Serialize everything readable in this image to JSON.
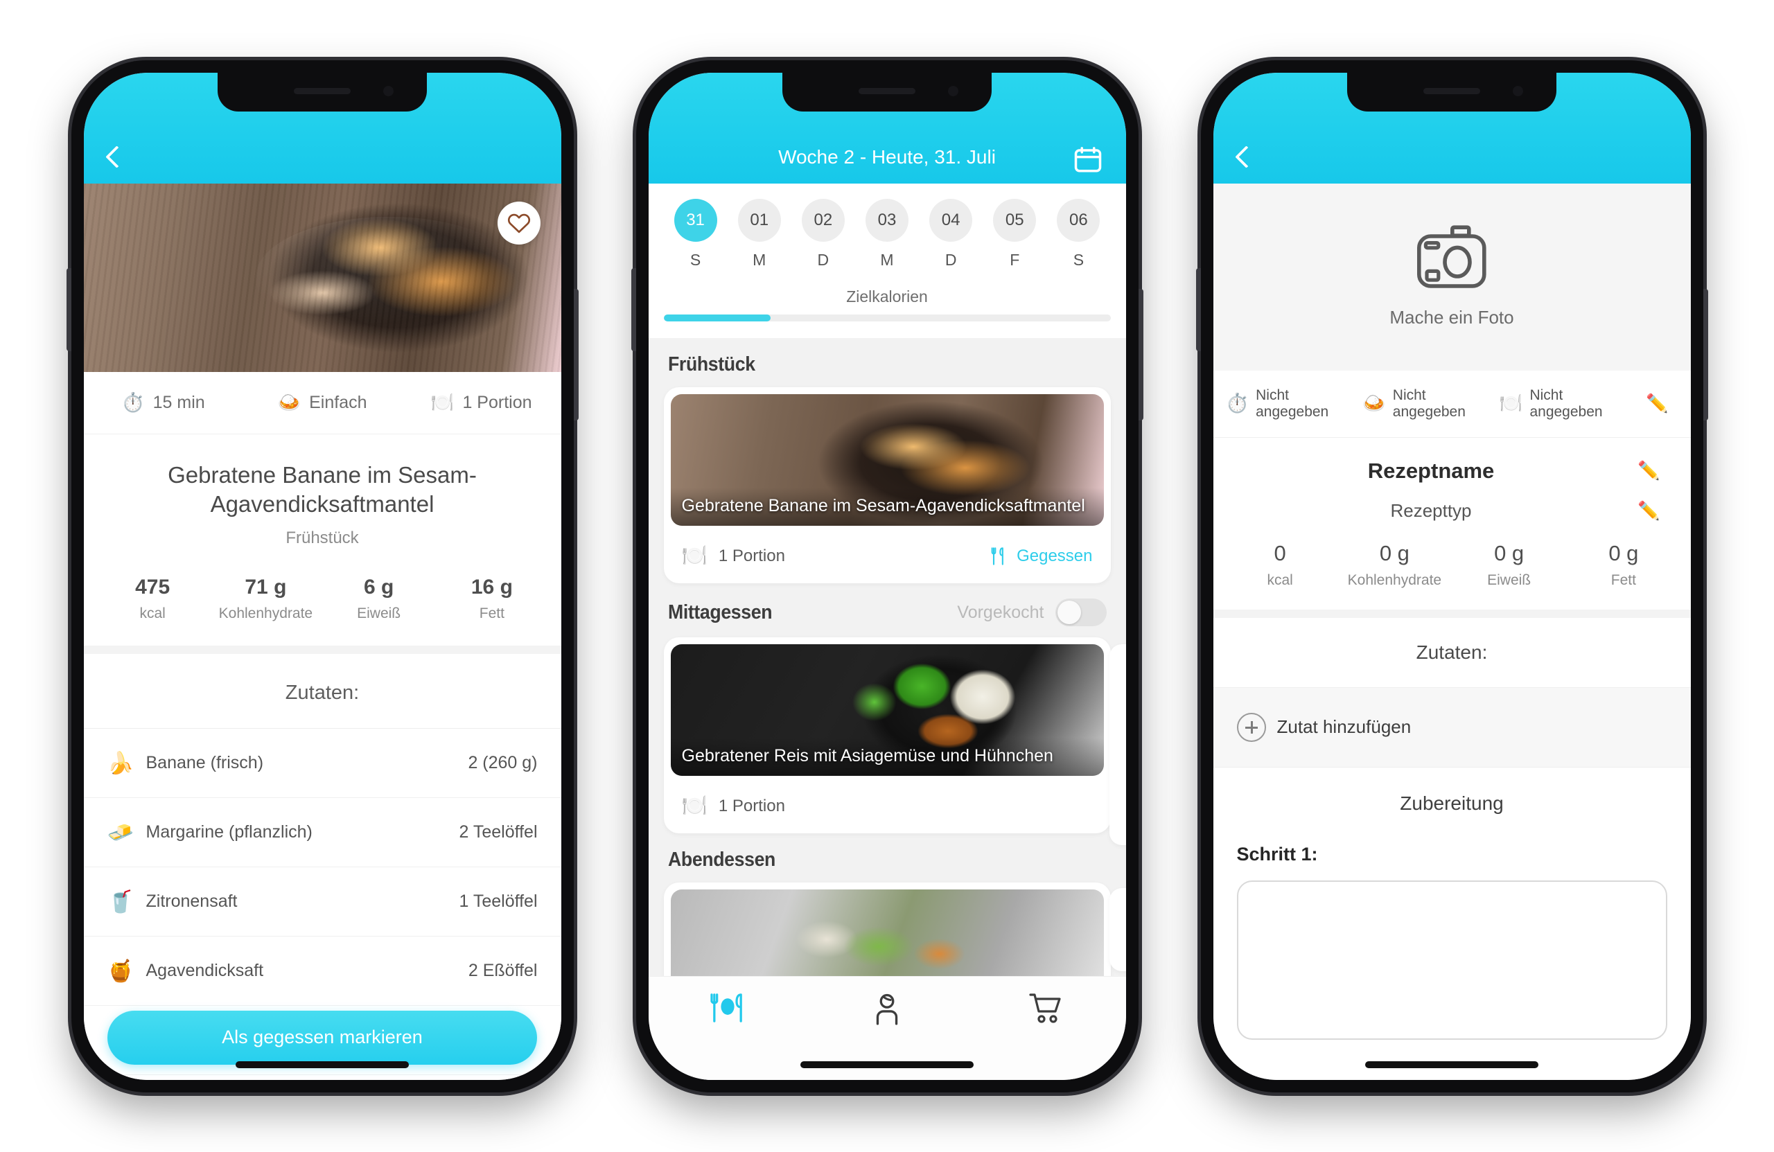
{
  "brand": {
    "accent": "#2ecdea",
    "accent_light": "#3ed3e8",
    "bg_gray": "#f2f2f2"
  },
  "phone1": {
    "name": "recipe-detail",
    "back_icon": "chevron-left-icon",
    "favorite_icon": "heart-icon",
    "meta": [
      {
        "icon": "stopwatch-emoji",
        "emoji": "⏱️",
        "label": "15 min"
      },
      {
        "icon": "cooking-difficulty-emoji",
        "emoji": "🍛",
        "label": "Einfach"
      },
      {
        "icon": "plate-cutlery-emoji",
        "emoji": "🍽️",
        "label": "1 Portion"
      }
    ],
    "title": "Gebratene Banane im Sesam-Agavendicksaftmantel",
    "subtitle": "Frühstück",
    "nutrition": [
      {
        "value": "475",
        "label": "kcal"
      },
      {
        "value": "71 g",
        "label": "Kohlenhydrate"
      },
      {
        "value": "6 g",
        "label": "Eiweiß"
      },
      {
        "value": "16 g",
        "label": "Fett"
      }
    ],
    "ingredients_heading": "Zutaten:",
    "ingredients": [
      {
        "emoji": "🍌",
        "icon": "banana-emoji",
        "name": "Banane (frisch)",
        "amount": "2 (260 g)"
      },
      {
        "emoji": "🧈",
        "icon": "butter-emoji",
        "name": "Margarine (pflanzlich)",
        "amount": "2 Teelöffel"
      },
      {
        "emoji": "🥤",
        "icon": "juice-glass-emoji",
        "name": "Zitronensaft",
        "amount": "1 Teelöffel"
      },
      {
        "emoji": "🍯",
        "icon": "syrup-bottle-emoji",
        "name": "Agavendicksaft",
        "amount": "2 Eßöffel"
      }
    ],
    "cta_label": "Als gegessen markieren"
  },
  "phone2": {
    "name": "weekly-plan",
    "header_title": "Woche 2 - Heute, 31. Juli",
    "calendar_icon": "calendar-icon",
    "days": [
      {
        "num": "31",
        "dow": "S",
        "active": true
      },
      {
        "num": "01",
        "dow": "M",
        "active": false
      },
      {
        "num": "02",
        "dow": "D",
        "active": false
      },
      {
        "num": "03",
        "dow": "M",
        "active": false
      },
      {
        "num": "04",
        "dow": "D",
        "active": false
      },
      {
        "num": "05",
        "dow": "F",
        "active": false
      },
      {
        "num": "06",
        "dow": "S",
        "active": false
      }
    ],
    "goal_label": "Zielkalorien",
    "goal_percent": 24,
    "meals": [
      {
        "section": "Frühstück",
        "has_toggle": false,
        "card_title": "Gebratene Banane im Sesam-Agavendicksaftmantel",
        "portion": "1 Portion",
        "eaten_label": "Gegessen",
        "eaten_icon": "fork-knife-icon"
      },
      {
        "section": "Mittagessen",
        "has_toggle": true,
        "toggle_label": "Vorgekocht",
        "card_title": "Gebratener Reis mit Asiagemüse und Hühnchen",
        "portion": "1 Portion",
        "eaten_label": "",
        "eaten_icon": ""
      },
      {
        "section": "Abendessen",
        "has_toggle": false,
        "card_title": "",
        "portion": "",
        "eaten_label": "",
        "eaten_icon": ""
      }
    ],
    "tabs": [
      {
        "icon": "plate-cutlery-icon",
        "name": "tab-meals",
        "active": true
      },
      {
        "icon": "person-icon",
        "name": "tab-profile",
        "active": false
      },
      {
        "icon": "shopping-cart-icon",
        "name": "tab-shopping",
        "active": false
      }
    ]
  },
  "phone3": {
    "name": "recipe-create",
    "back_icon": "chevron-left-icon",
    "photo_icon": "camera-icon",
    "photo_label": "Mache ein Foto",
    "meta": [
      {
        "emoji": "⏱️",
        "icon": "stopwatch-emoji",
        "label": "Nicht angegeben"
      },
      {
        "emoji": "🍛",
        "icon": "cooking-difficulty-emoji",
        "label": "Nicht angegeben"
      },
      {
        "emoji": "🍽️",
        "icon": "plate-cutlery-emoji",
        "label": "Nicht angegeben"
      }
    ],
    "meta_edit_icon": "pencil-emoji",
    "meta_edit_emoji": "✏️",
    "recipe_name_placeholder": "Rezeptname",
    "recipe_type_placeholder": "Rezepttyp",
    "edit_emoji": "✏️",
    "nutrition": [
      {
        "value": "0",
        "label": "kcal"
      },
      {
        "value": "0 g",
        "label": "Kohlenhydrate"
      },
      {
        "value": "0 g",
        "label": "Eiweiß"
      },
      {
        "value": "0 g",
        "label": "Fett"
      }
    ],
    "ingredients_heading": "Zutaten:",
    "add_ingredient_label": "Zutat hinzufügen",
    "add_icon": "plus-circle-icon",
    "preparation_heading": "Zubereitung",
    "step_label": "Schritt 1:",
    "step_value": ""
  }
}
